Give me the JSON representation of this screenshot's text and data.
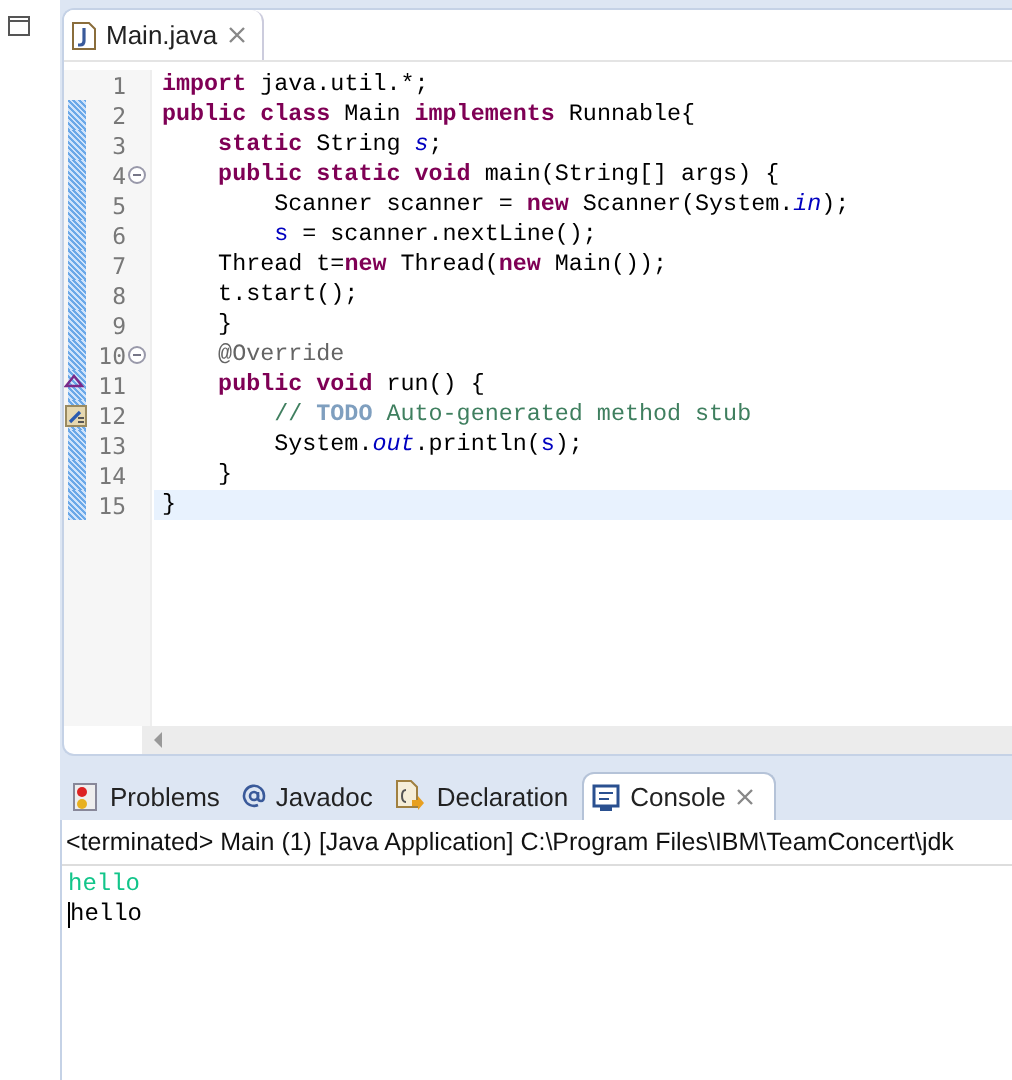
{
  "editor": {
    "tab": {
      "label": "Main.java",
      "selected": true
    },
    "lines": [
      {
        "number": "1",
        "changed": false,
        "kind": "plain",
        "current": false,
        "tokens": [
          {
            "kind": "keyword",
            "text": "import"
          },
          {
            "kind": "plain",
            "text": " java.util.*;"
          }
        ]
      },
      {
        "number": "2",
        "changed": true,
        "kind": "plain",
        "current": false,
        "tokens": [
          {
            "kind": "keyword",
            "text": "public class"
          },
          {
            "kind": "plain",
            "text": " Main "
          },
          {
            "kind": "keyword",
            "text": "implements"
          },
          {
            "kind": "plain",
            "text": " Runnable{"
          }
        ]
      },
      {
        "number": "3",
        "changed": true,
        "kind": "plain",
        "current": false,
        "tokens": [
          {
            "kind": "keyword",
            "text": "    static"
          },
          {
            "kind": "plain",
            "text": " String "
          },
          {
            "kind": "static-field",
            "text": "s"
          },
          {
            "kind": "plain",
            "text": ";"
          }
        ]
      },
      {
        "number": "4",
        "changed": true,
        "kind": "fold",
        "current": false,
        "tokens": [
          {
            "kind": "keyword",
            "text": "    public static void"
          },
          {
            "kind": "plain",
            "text": " main(String[] args) {"
          }
        ]
      },
      {
        "number": "5",
        "changed": true,
        "kind": "plain",
        "current": false,
        "tokens": [
          {
            "kind": "plain",
            "text": "        Scanner scanner = "
          },
          {
            "kind": "keyword",
            "text": "new"
          },
          {
            "kind": "plain",
            "text": " Scanner(System."
          },
          {
            "kind": "static-field",
            "text": "in"
          },
          {
            "kind": "plain",
            "text": ");"
          }
        ]
      },
      {
        "number": "6",
        "changed": true,
        "kind": "plain",
        "current": false,
        "tokens": [
          {
            "kind": "field",
            "text": "        s"
          },
          {
            "kind": "plain",
            "text": " = scanner.nextLine();"
          }
        ]
      },
      {
        "number": "7",
        "changed": true,
        "kind": "plain",
        "current": false,
        "tokens": [
          {
            "kind": "plain",
            "text": "    Thread t="
          },
          {
            "kind": "keyword",
            "text": "new"
          },
          {
            "kind": "plain",
            "text": " Thread("
          },
          {
            "kind": "keyword",
            "text": "new"
          },
          {
            "kind": "plain",
            "text": " Main());"
          }
        ]
      },
      {
        "number": "8",
        "changed": true,
        "kind": "plain",
        "current": false,
        "tokens": [
          {
            "kind": "plain",
            "text": "    t.start();"
          }
        ]
      },
      {
        "number": "9",
        "changed": true,
        "kind": "plain",
        "current": false,
        "tokens": [
          {
            "kind": "plain",
            "text": "    }"
          }
        ]
      },
      {
        "number": "10",
        "changed": true,
        "kind": "fold",
        "current": false,
        "tokens": [
          {
            "kind": "annotation",
            "text": "    @Override"
          }
        ]
      },
      {
        "number": "11",
        "changed": true,
        "kind": "override",
        "current": false,
        "tokens": [
          {
            "kind": "keyword",
            "text": "    public void"
          },
          {
            "kind": "plain",
            "text": " run() {"
          }
        ]
      },
      {
        "number": "12",
        "changed": true,
        "kind": "task",
        "current": false,
        "tokens": [
          {
            "kind": "comment",
            "text": "        // "
          },
          {
            "kind": "todo",
            "text": "TODO"
          },
          {
            "kind": "comment",
            "text": " Auto-generated method stub"
          }
        ]
      },
      {
        "number": "13",
        "changed": true,
        "kind": "plain",
        "current": false,
        "tokens": [
          {
            "kind": "plain",
            "text": "        System."
          },
          {
            "kind": "static-field",
            "text": "out"
          },
          {
            "kind": "plain",
            "text": ".println("
          },
          {
            "kind": "field",
            "text": "s"
          },
          {
            "kind": "plain",
            "text": ");"
          }
        ]
      },
      {
        "number": "14",
        "changed": true,
        "kind": "plain",
        "current": false,
        "tokens": [
          {
            "kind": "plain",
            "text": "    }"
          }
        ]
      },
      {
        "number": "15",
        "changed": true,
        "kind": "plain",
        "current": true,
        "tokens": [
          {
            "kind": "plain",
            "text": "}"
          }
        ]
      }
    ]
  },
  "panel": {
    "tabs": [
      {
        "label": "Problems",
        "selected": false
      },
      {
        "label": "Javadoc",
        "selected": false
      },
      {
        "label": "Declaration",
        "selected": false
      },
      {
        "label": "Console",
        "selected": true
      }
    ],
    "status": "<terminated> Main (1) [Java Application] C:\\Program Files\\IBM\\TeamConcert\\jdk",
    "output": [
      {
        "kind": "input",
        "text": "hello"
      },
      {
        "kind": "output",
        "text": "hello"
      }
    ]
  }
}
